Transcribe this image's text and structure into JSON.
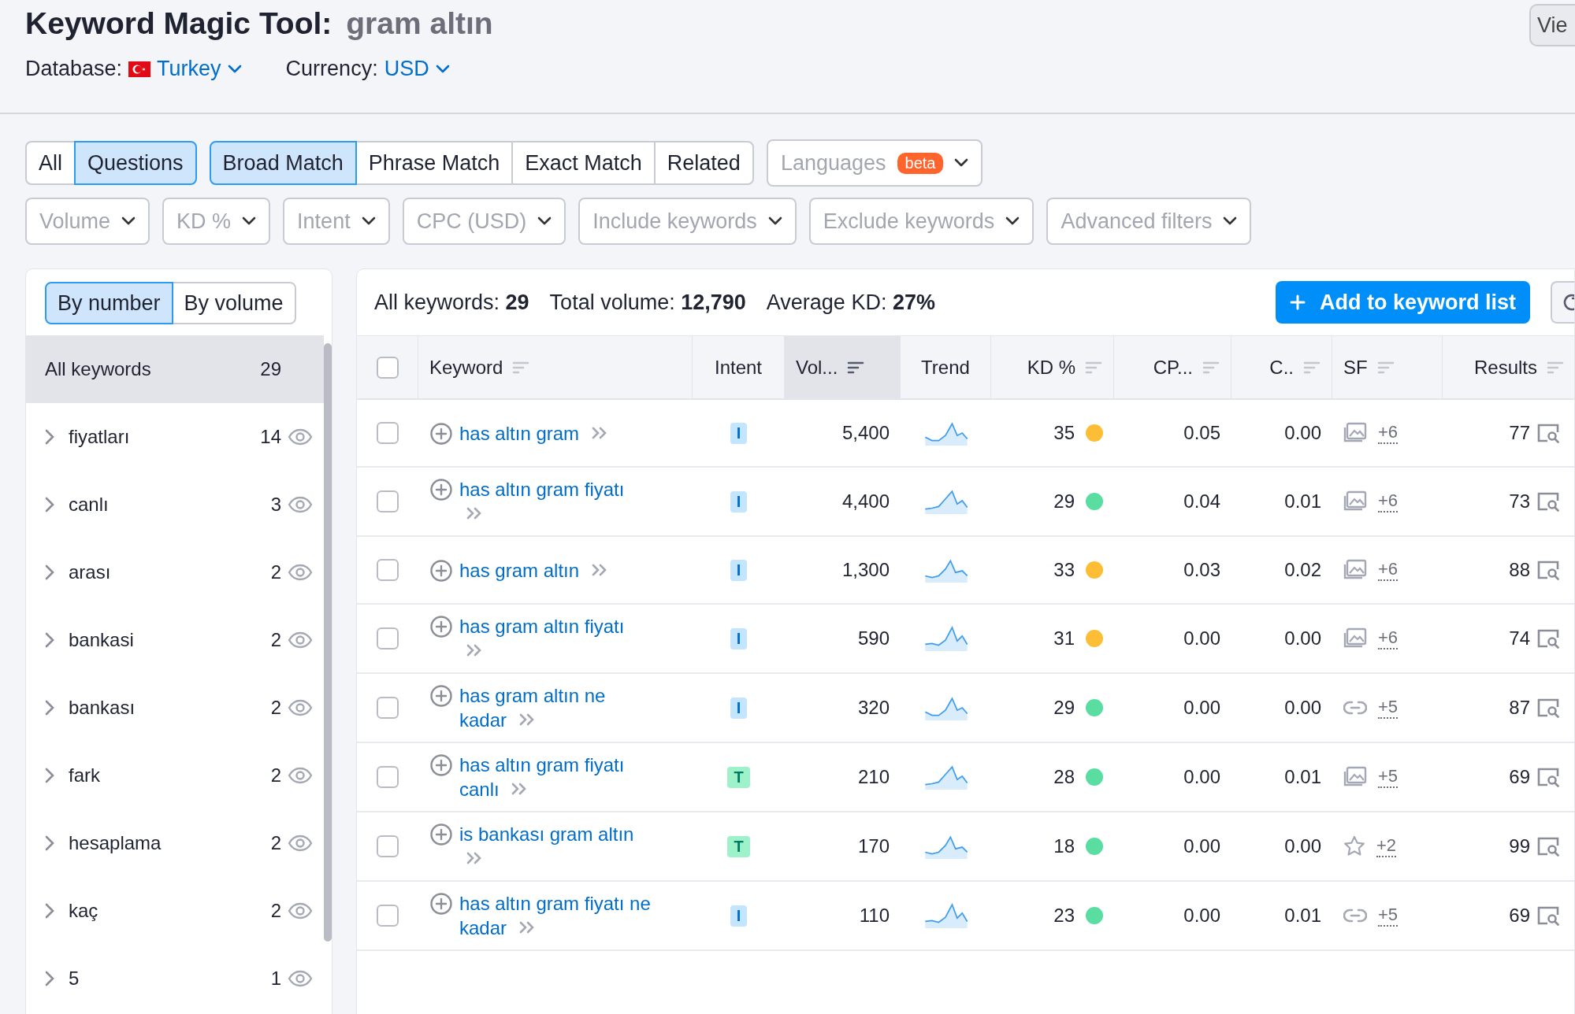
{
  "header": {
    "title": "Keyword Magic Tool:",
    "query": "gram altın",
    "database_label": "Database:",
    "database": "Turkey",
    "currency_label": "Currency:",
    "currency": "USD",
    "view_button": "Vie"
  },
  "question_tabs": [
    {
      "label": "All",
      "selected": false
    },
    {
      "label": "Questions",
      "selected": true
    }
  ],
  "match_tabs": [
    {
      "label": "Broad Match",
      "selected": true
    },
    {
      "label": "Phrase Match",
      "selected": false
    },
    {
      "label": "Exact Match",
      "selected": false
    },
    {
      "label": "Related",
      "selected": false
    }
  ],
  "languages": {
    "label": "Languages",
    "badge": "beta"
  },
  "filters": [
    "Volume",
    "KD %",
    "Intent",
    "CPC (USD)",
    "Include keywords",
    "Exclude keywords",
    "Advanced filters"
  ],
  "sidebar": {
    "toggle": [
      {
        "label": "By number",
        "selected": true
      },
      {
        "label": "By volume",
        "selected": false
      }
    ],
    "items": [
      {
        "kind": "all",
        "label": "All keywords",
        "count": "29",
        "selected": true
      },
      {
        "kind": "group",
        "label": "fiyatları",
        "count": "14",
        "selected": false
      },
      {
        "kind": "group",
        "label": "canlı",
        "count": "3",
        "selected": false
      },
      {
        "kind": "group",
        "label": "arası",
        "count": "2",
        "selected": false
      },
      {
        "kind": "group",
        "label": "bankasi",
        "count": "2",
        "selected": false
      },
      {
        "kind": "group",
        "label": "bankası",
        "count": "2",
        "selected": false
      },
      {
        "kind": "group",
        "label": "fark",
        "count": "2",
        "selected": false
      },
      {
        "kind": "group",
        "label": "hesaplama",
        "count": "2",
        "selected": false
      },
      {
        "kind": "group",
        "label": "kaç",
        "count": "2",
        "selected": false
      },
      {
        "kind": "group",
        "label": "5",
        "count": "1",
        "selected": false
      }
    ]
  },
  "summary": [
    {
      "label": "All keywords:",
      "value": "29"
    },
    {
      "label": "Total volume:",
      "value": "12,790"
    },
    {
      "label": "Average KD:",
      "value": "27%"
    }
  ],
  "add_button": "Add to keyword list",
  "table": {
    "header_checked": false,
    "columns": [
      {
        "label": "Keyword",
        "sorted": false
      },
      {
        "label": "Intent",
        "sorted": false
      },
      {
        "label": "Vol...",
        "sorted": true
      },
      {
        "label": "Trend",
        "sorted": false
      },
      {
        "label": "KD %",
        "sorted": false
      },
      {
        "label": "CP...",
        "sorted": false
      },
      {
        "label": "C..",
        "sorted": false
      },
      {
        "label": "SF",
        "sorted": false
      },
      {
        "label": "Results",
        "sorted": false
      }
    ],
    "rows": [
      {
        "checked": false,
        "keyword": "has altın gram",
        "intent": {
          "label": "I",
          "kind": "informational"
        },
        "volume": "5,400",
        "kd": {
          "value": "35",
          "color": "#fdbe36"
        },
        "cpc": "0.05",
        "com": "0.00",
        "sf": {
          "kind": "image",
          "more": "+6"
        },
        "results": "77"
      },
      {
        "checked": false,
        "keyword": "has altın gram fiyatı",
        "intent": {
          "label": "I",
          "kind": "informational"
        },
        "volume": "4,400",
        "kd": {
          "value": "29",
          "color": "#59dda1"
        },
        "cpc": "0.04",
        "com": "0.01",
        "sf": {
          "kind": "image",
          "more": "+6"
        },
        "results": "73"
      },
      {
        "checked": false,
        "keyword": "has gram altın",
        "intent": {
          "label": "I",
          "kind": "informational"
        },
        "volume": "1,300",
        "kd": {
          "value": "33",
          "color": "#fdbe36"
        },
        "cpc": "0.03",
        "com": "0.02",
        "sf": {
          "kind": "image",
          "more": "+6"
        },
        "results": "88"
      },
      {
        "checked": false,
        "keyword": "has gram altın fiyatı",
        "intent": {
          "label": "I",
          "kind": "informational"
        },
        "volume": "590",
        "kd": {
          "value": "31",
          "color": "#fdbe36"
        },
        "cpc": "0.00",
        "com": "0.00",
        "sf": {
          "kind": "image",
          "more": "+6"
        },
        "results": "74"
      },
      {
        "checked": false,
        "keyword": "has gram altın ne kadar",
        "intent": {
          "label": "I",
          "kind": "informational"
        },
        "volume": "320",
        "kd": {
          "value": "29",
          "color": "#59dda1"
        },
        "cpc": "0.00",
        "com": "0.00",
        "sf": {
          "kind": "link",
          "more": "+5"
        },
        "results": "87"
      },
      {
        "checked": false,
        "keyword": "has altın gram fiyatı canlı",
        "intent": {
          "label": "T",
          "kind": "transactional"
        },
        "volume": "210",
        "kd": {
          "value": "28",
          "color": "#59dda1"
        },
        "cpc": "0.00",
        "com": "0.01",
        "sf": {
          "kind": "image",
          "more": "+5"
        },
        "results": "69"
      },
      {
        "checked": false,
        "keyword": "is bankası gram altın",
        "intent": {
          "label": "T",
          "kind": "transactional"
        },
        "volume": "170",
        "kd": {
          "value": "18",
          "color": "#59dda1"
        },
        "cpc": "0.00",
        "com": "0.00",
        "sf": {
          "kind": "star",
          "more": "+2"
        },
        "results": "99"
      },
      {
        "checked": false,
        "keyword": "has altın gram fiyatı ne kadar",
        "intent": {
          "label": "I",
          "kind": "informational"
        },
        "volume": "110",
        "kd": {
          "value": "23",
          "color": "#59dda1"
        },
        "cpc": "0.00",
        "com": "0.01",
        "sf": {
          "kind": "link",
          "more": "+5"
        },
        "results": "69"
      }
    ]
  }
}
